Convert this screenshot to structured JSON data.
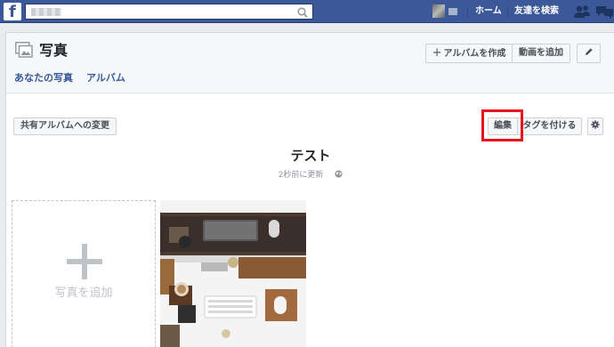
{
  "topbar": {
    "logo": "f",
    "nav": {
      "home": "ホーム",
      "find_friends": "友達を検索"
    },
    "icons": [
      "search-icon",
      "friend-requests-icon",
      "messages-icon"
    ]
  },
  "header": {
    "title": "写真",
    "tabs": [
      {
        "label": "あなたの写真"
      },
      {
        "label": "アルバム"
      }
    ],
    "buttons": {
      "create_album": "アルバムを作成",
      "add_video": "動画を追加"
    }
  },
  "album": {
    "shared_button": "共有アルバムへの変更",
    "edit_button": "編集",
    "tag_button": "タグを付ける",
    "title": "テスト",
    "updated": "2秒前に更新"
  },
  "add_photo": {
    "label": "写真を追加"
  },
  "colors": {
    "brand": "#3b5998",
    "link": "#365899",
    "highlight": "#e8141c"
  }
}
